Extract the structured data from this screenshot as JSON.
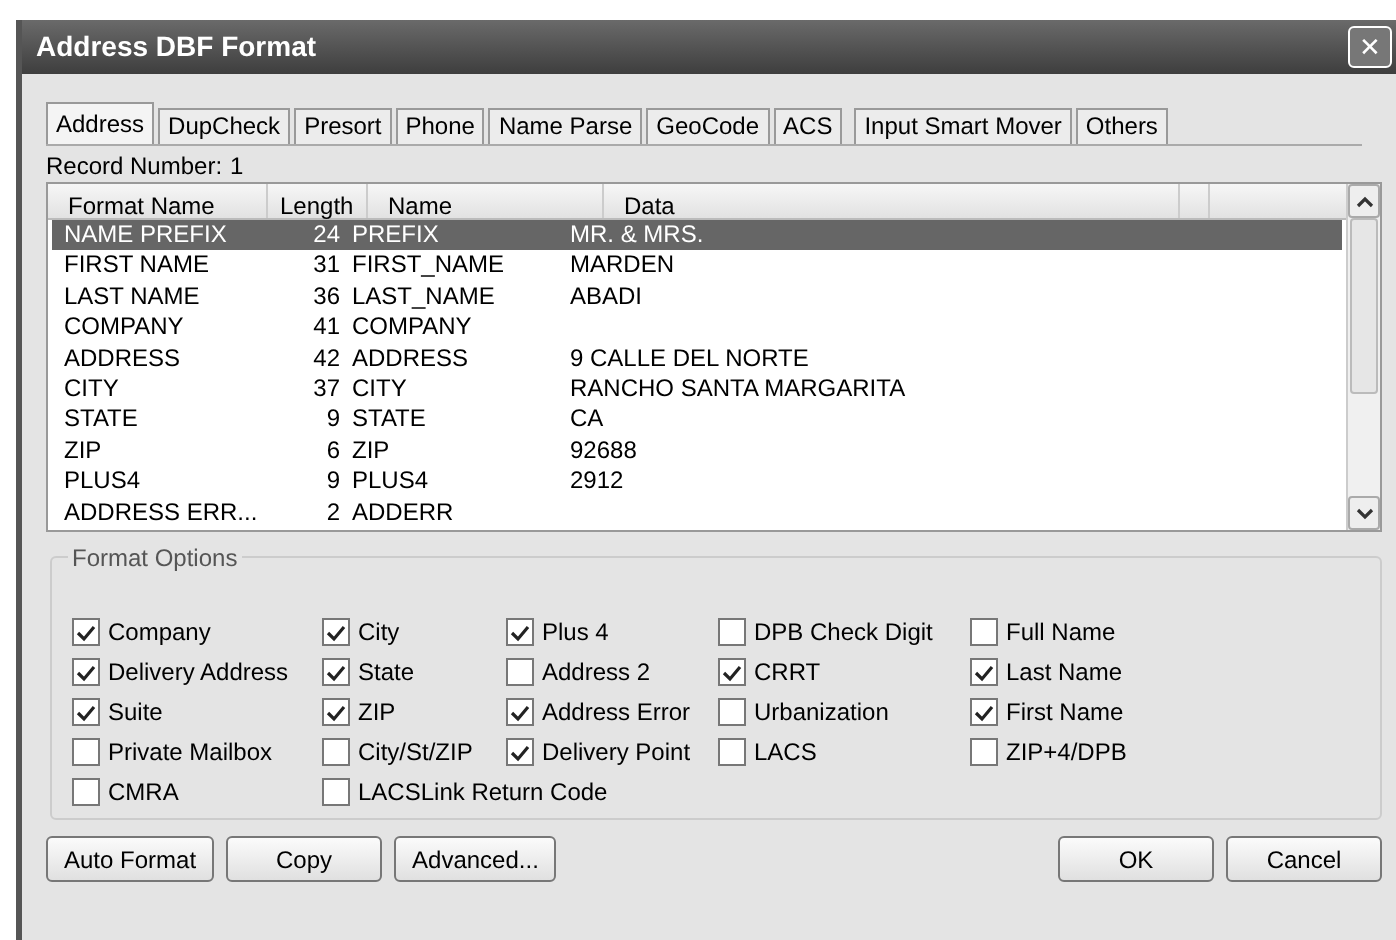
{
  "window": {
    "title": "Address DBF Format",
    "close": "✕"
  },
  "tabs": [
    {
      "label": "Address",
      "selected": true
    },
    {
      "label": "DupCheck",
      "selected": false
    },
    {
      "label": "Presort",
      "selected": false
    },
    {
      "label": "Phone",
      "selected": false
    },
    {
      "label": "Name Parse",
      "selected": false
    },
    {
      "label": "GeoCode",
      "selected": false
    },
    {
      "label": "ACS",
      "selected": false
    },
    {
      "label": "Input Smart Mover",
      "selected": false
    },
    {
      "label": "Others",
      "selected": false
    }
  ],
  "record_number": {
    "label": "Record Number:",
    "value": "1"
  },
  "table": {
    "columns": [
      "Format Name",
      "Length",
      "Name",
      "Data"
    ],
    "rows": [
      {
        "cells": [
          "NAME PREFIX",
          "24",
          "PREFIX",
          "MR. & MRS."
        ],
        "selected": true
      },
      {
        "cells": [
          "FIRST NAME",
          "31",
          "FIRST_NAME",
          "MARDEN"
        ],
        "selected": false
      },
      {
        "cells": [
          "LAST NAME",
          "36",
          "LAST_NAME",
          "ABADI"
        ],
        "selected": false
      },
      {
        "cells": [
          "COMPANY",
          "41",
          "COMPANY",
          ""
        ],
        "selected": false
      },
      {
        "cells": [
          "ADDRESS",
          "42",
          "ADDRESS",
          "9 CALLE DEL NORTE"
        ],
        "selected": false
      },
      {
        "cells": [
          "CITY",
          "37",
          "CITY",
          "RANCHO SANTA MARGARITA"
        ],
        "selected": false
      },
      {
        "cells": [
          "STATE",
          "9",
          "STATE",
          "CA"
        ],
        "selected": false
      },
      {
        "cells": [
          "ZIP",
          "6",
          "ZIP",
          "92688"
        ],
        "selected": false
      },
      {
        "cells": [
          "PLUS4",
          "9",
          "PLUS4",
          "2912"
        ],
        "selected": false
      },
      {
        "cells": [
          "ADDRESS ERR...",
          "2",
          "ADDERR",
          ""
        ],
        "selected": false
      }
    ]
  },
  "format_options": {
    "title": "Format Options",
    "columns": [
      [
        {
          "label": "Company",
          "checked": true
        },
        {
          "label": "Delivery Address",
          "checked": true
        },
        {
          "label": "Suite",
          "checked": true
        },
        {
          "label": "Private Mailbox",
          "checked": false
        },
        {
          "label": "CMRA",
          "checked": false
        }
      ],
      [
        {
          "label": "City",
          "checked": true
        },
        {
          "label": "State",
          "checked": true
        },
        {
          "label": "ZIP",
          "checked": true
        },
        {
          "label": "City/St/ZIP",
          "checked": false
        },
        {
          "label": "LACSLink Return Code",
          "checked": false
        }
      ],
      [
        {
          "label": "Plus 4",
          "checked": true
        },
        {
          "label": "Address 2",
          "checked": false
        },
        {
          "label": "Address Error",
          "checked": true
        },
        {
          "label": "Delivery Point",
          "checked": true
        }
      ],
      [
        {
          "label": "DPB Check Digit",
          "checked": false
        },
        {
          "label": "CRRT",
          "checked": true
        },
        {
          "label": "Urbanization",
          "checked": false
        },
        {
          "label": "LACS",
          "checked": false
        }
      ],
      [
        {
          "label": "Full Name",
          "checked": false
        },
        {
          "label": "Last Name",
          "checked": true
        },
        {
          "label": "First Name",
          "checked": true
        },
        {
          "label": "ZIP+4/DPB",
          "checked": false
        }
      ]
    ]
  },
  "buttons_left": [
    "Auto Format",
    "Copy",
    "Advanced..."
  ],
  "buttons_right": [
    "OK",
    "Cancel"
  ]
}
